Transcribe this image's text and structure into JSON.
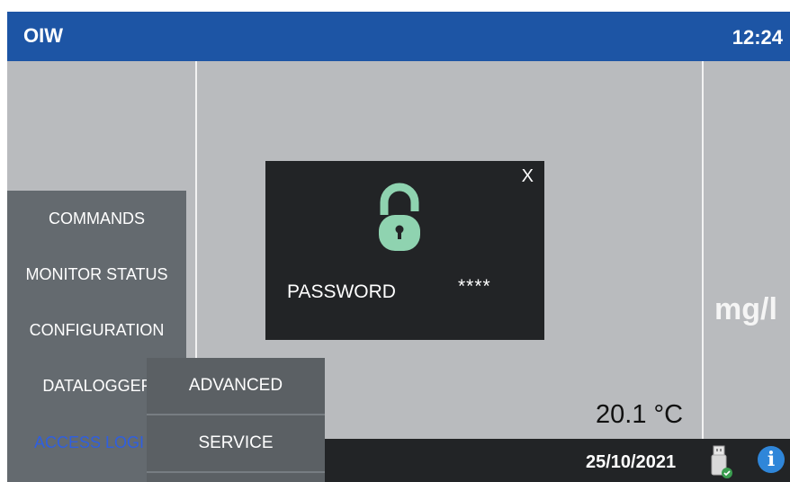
{
  "header": {
    "title": "OIW",
    "time": "12:24"
  },
  "main": {
    "unit": "mg/l",
    "temperature": "20.1 °C"
  },
  "status": {
    "date": "25/10/2021",
    "usb_icon": "usb-drive-icon",
    "info_icon": "info-icon",
    "info_glyph": "i"
  },
  "menu": {
    "items": [
      {
        "label": "COMMANDS"
      },
      {
        "label": "MONITOR STATUS"
      },
      {
        "label": "CONFIGURATION"
      },
      {
        "label": "DATALOGGEF"
      },
      {
        "label": "ACCESS LOGI"
      }
    ],
    "submenu": [
      {
        "label": "ADVANCED"
      },
      {
        "label": "SERVICE"
      }
    ]
  },
  "dialog": {
    "close_label": "X",
    "lock_icon": "lock-icon",
    "password_label": "PASSWORD",
    "password_value": "****"
  },
  "colors": {
    "header": "#1d55a5",
    "background": "#b9bbbe",
    "menu": "#646a6f",
    "dialog": "#222426",
    "lock": "#8fd3b0",
    "active": "#2f5fe0"
  }
}
